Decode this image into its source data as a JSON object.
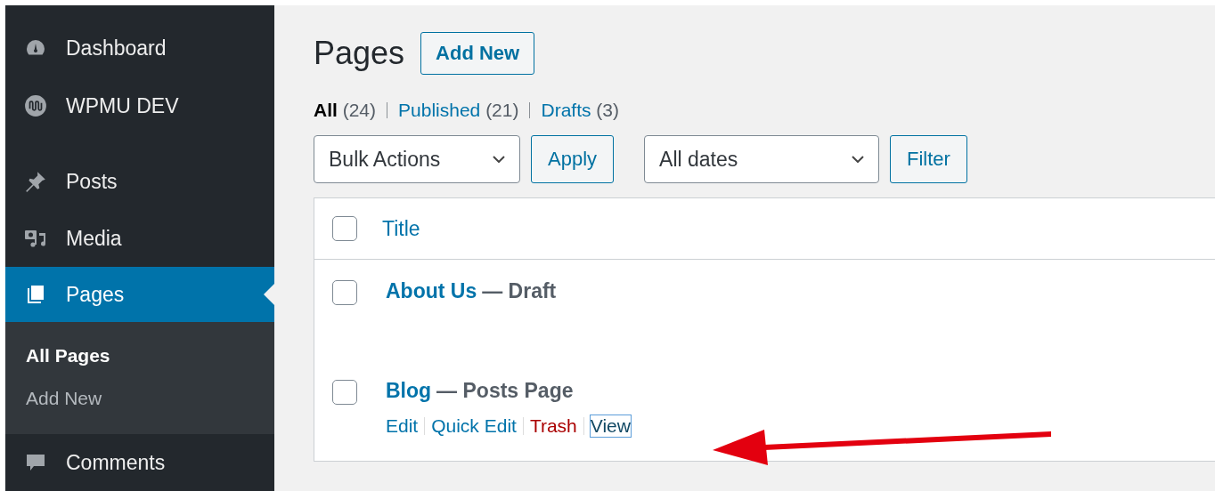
{
  "sidebar": {
    "items": [
      {
        "label": "Dashboard",
        "selected": false
      },
      {
        "label": "WPMU DEV",
        "selected": false
      },
      {
        "label": "Posts",
        "selected": false
      },
      {
        "label": "Media",
        "selected": false
      },
      {
        "label": "Pages",
        "selected": true,
        "children": [
          {
            "label": "All Pages",
            "selected": true
          },
          {
            "label": "Add New",
            "selected": false
          }
        ]
      },
      {
        "label": "Comments",
        "selected": false
      }
    ]
  },
  "page": {
    "title": "Pages",
    "add_button": "Add New"
  },
  "views": [
    {
      "label": "All",
      "count": "(24)",
      "selected": true
    },
    {
      "label": "Published",
      "count": "(21)",
      "selected": false
    },
    {
      "label": "Drafts",
      "count": "(3)",
      "selected": false
    }
  ],
  "filters": {
    "bulk_select": "Bulk Actions",
    "apply": "Apply",
    "date_select": "All dates",
    "filter": "Filter"
  },
  "table": {
    "columns": [
      {
        "label": "Title",
        "checked": false
      }
    ],
    "rows": [
      {
        "title": "About Us",
        "state": "— Draft",
        "checked": false,
        "actions": []
      },
      {
        "title": "Blog",
        "state": "— Posts Page",
        "checked": false,
        "actions": [
          {
            "label": "Edit",
            "kind": "link",
            "focused": false
          },
          {
            "label": "Quick Edit",
            "kind": "link",
            "focused": false
          },
          {
            "label": "Trash",
            "kind": "delete",
            "focused": false
          },
          {
            "label": "View",
            "kind": "link",
            "focused": true
          }
        ]
      }
    ]
  },
  "annotation": {
    "kind": "arrow"
  }
}
